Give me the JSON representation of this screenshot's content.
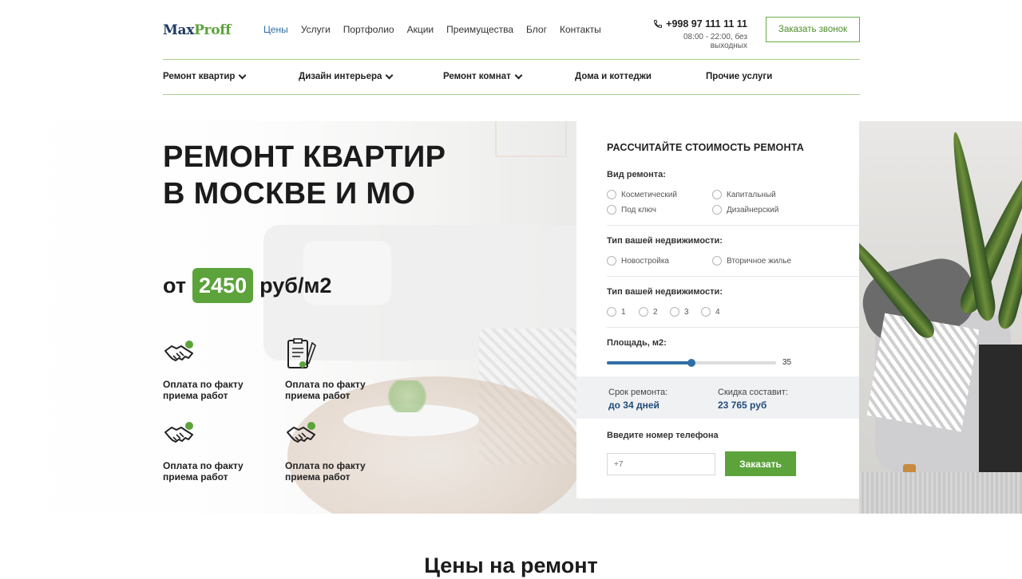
{
  "header": {
    "logo_part1": "Max",
    "logo_part2": "Proff",
    "nav": [
      "Цены",
      "Услуги",
      "Портфолио",
      "Акции",
      "Преимущества",
      "Блог",
      "Контакты"
    ],
    "phone": "+998 97 111 11 11",
    "hours": "08:00 - 22:00, без выходных",
    "call_button": "Заказать звонок",
    "phone_icon": "phone-icon"
  },
  "subnav": {
    "items": [
      {
        "label": "Ремонт квартир",
        "dropdown": true
      },
      {
        "label": "Дизайн интерьера",
        "dropdown": true
      },
      {
        "label": "Ремонт комнат",
        "dropdown": true
      },
      {
        "label": "Дома и коттеджи",
        "dropdown": false
      },
      {
        "label": "Прочие услуги",
        "dropdown": false
      }
    ]
  },
  "hero": {
    "title_line1": "РЕМОНТ КВАРТИР",
    "title_line2": "В МОСКВЕ И МО",
    "price_prefix": "от",
    "price_value": "2450",
    "price_unit": "руб/м2",
    "features": [
      {
        "icon": "handshake-icon",
        "text": "Оплата по факту приема работ"
      },
      {
        "icon": "contract-icon",
        "text": "Оплата по факту приема работ"
      },
      {
        "icon": "handshake-icon",
        "text": "Оплата по факту приема работ"
      },
      {
        "icon": "handshake-icon",
        "text": "Оплата по факту приема работ"
      }
    ]
  },
  "calculator": {
    "title": "РАССЧИТАЙТЕ СТОИМОСТЬ РЕМОНТА",
    "repair_type_label": "Вид ремонта:",
    "repair_types": [
      "Косметический",
      "Капитальный",
      "Под ключ",
      "Дизайнерский"
    ],
    "property_type_label": "Тип вашей недвижимости:",
    "property_types": [
      "Новостройка",
      "Вторичное жилье"
    ],
    "rooms_label": "Тип вашей недвижимости:",
    "rooms": [
      "1",
      "2",
      "3",
      "4"
    ],
    "area_label": "Площадь, м2:",
    "area_value": "35",
    "area_fraction": 0.5,
    "term_label": "Срок ремонта:",
    "term_value": "до 34 дней",
    "discount_label": "Скидка составит:",
    "discount_value": "23 765 руб",
    "phone_label": "Введите номер телефона",
    "phone_placeholder": "+7",
    "order_button": "Заказать"
  },
  "prices_section": {
    "title": "Цены на ремонт"
  },
  "colors": {
    "accent_green": "#5ba33a",
    "accent_blue": "#2f6ea5"
  }
}
